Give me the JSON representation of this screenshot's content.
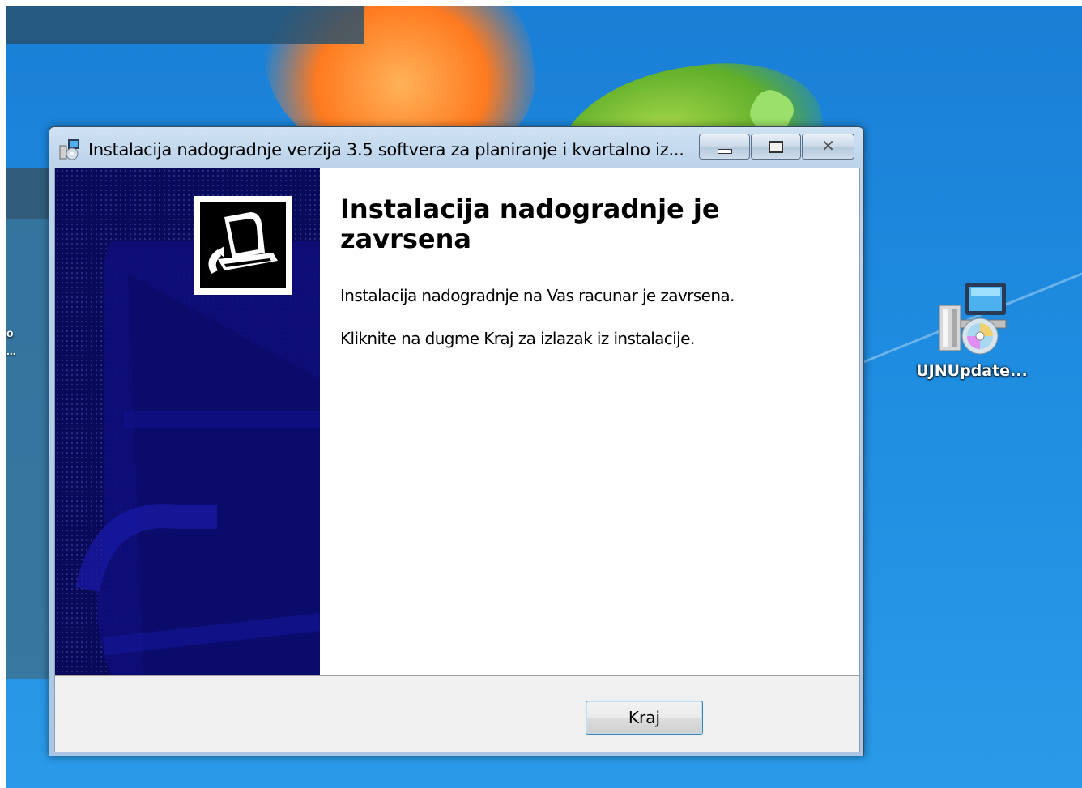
{
  "window": {
    "title": "Instalacija nadogradnje verzija 3.5 softvera za planiranje i kvartalno iz...",
    "controls": {
      "minimize": "",
      "maximize": "",
      "close": "✕"
    }
  },
  "page": {
    "heading": "Instalacija nadogradnje je zavrsena",
    "line1": "Instalacija nadogradnje na Vas racunar je zavrsena.",
    "line2": "Kliknite na dugme Kraj za izlazak iz instalacije."
  },
  "footer": {
    "finish_label": "Kraj"
  },
  "desktop": {
    "icon_label": "UJNUpdate...",
    "left_edge_text": "o\n..."
  },
  "colors": {
    "sidebar_bg": "#0a0a5a",
    "desktop_blue": "#1e8ce0",
    "finish_border": "#3c7fb1"
  },
  "icons": [
    "installer-icon",
    "setup-computer-icon",
    "minimize-icon",
    "maximize-icon",
    "close-icon",
    "setup-package-icon"
  ]
}
